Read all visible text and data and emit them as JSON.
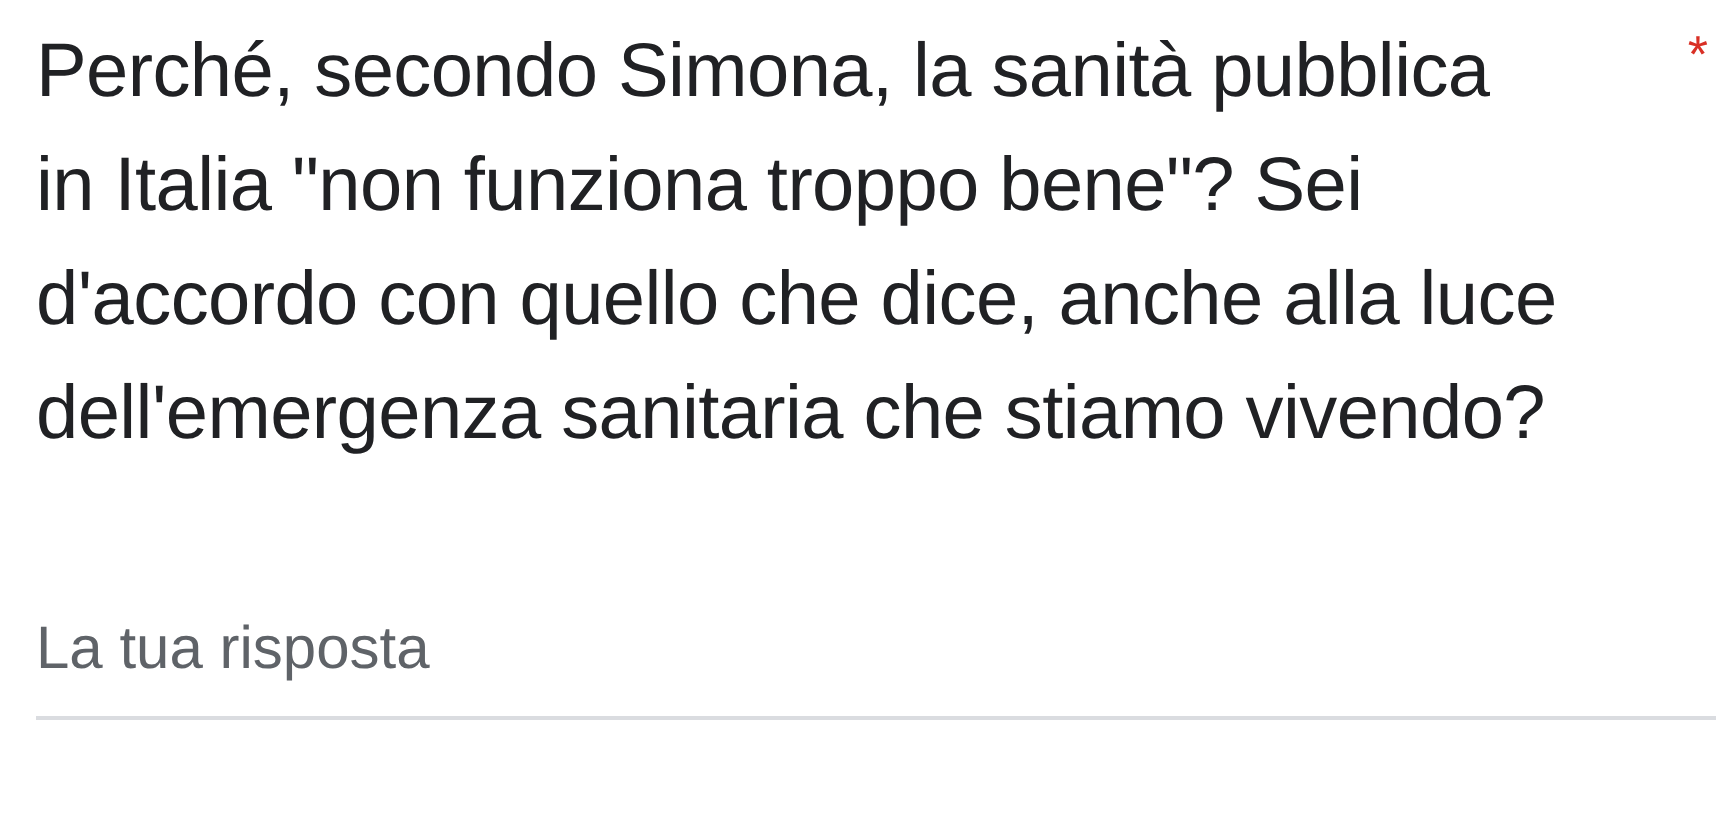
{
  "question": {
    "text": "Perché, secondo Simona, la sanità pubblica\nin Italia \"non funziona troppo bene\"? Sei\nd'accordo con quello che dice, anche alla luce\ndell'emergenza sanitaria che stiamo vivendo?",
    "required_mark": "*"
  },
  "answer": {
    "placeholder": "La tua risposta"
  }
}
